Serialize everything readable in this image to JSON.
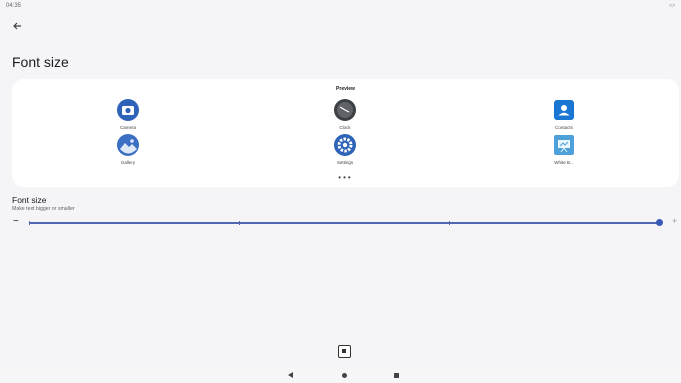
{
  "status_bar": {
    "time": "04:35",
    "right_indicator": "<>"
  },
  "page": {
    "title": "Font size"
  },
  "preview": {
    "label": "Preview",
    "apps": [
      {
        "label": "Camera",
        "icon": "camera-icon",
        "color": "#2e63b8"
      },
      {
        "label": "Clock",
        "icon": "clock-icon",
        "color": "#3c4043"
      },
      {
        "label": "Contacts",
        "icon": "contacts-icon",
        "color": "#1976d2"
      },
      {
        "label": "Gallery",
        "icon": "gallery-icon",
        "color": "#3a6fc4"
      },
      {
        "label": "Settings",
        "icon": "settings-icon",
        "color": "#2e63b8"
      },
      {
        "label": "White B...",
        "icon": "whiteboard-icon",
        "color": "#4ea0d8"
      }
    ],
    "more_indicator": "•••"
  },
  "font_size": {
    "title": "Font size",
    "subtitle": "Make text bigger or smaller",
    "minus": "−",
    "plus": "+",
    "level": 1.0,
    "steps": 4
  },
  "nav": {
    "back_icon": "back-triangle-icon",
    "home_icon": "home-circle-icon",
    "recents_icon": "recents-square-icon"
  },
  "colors": {
    "accent": "#3a58b6",
    "background": "#f5f5f7"
  }
}
